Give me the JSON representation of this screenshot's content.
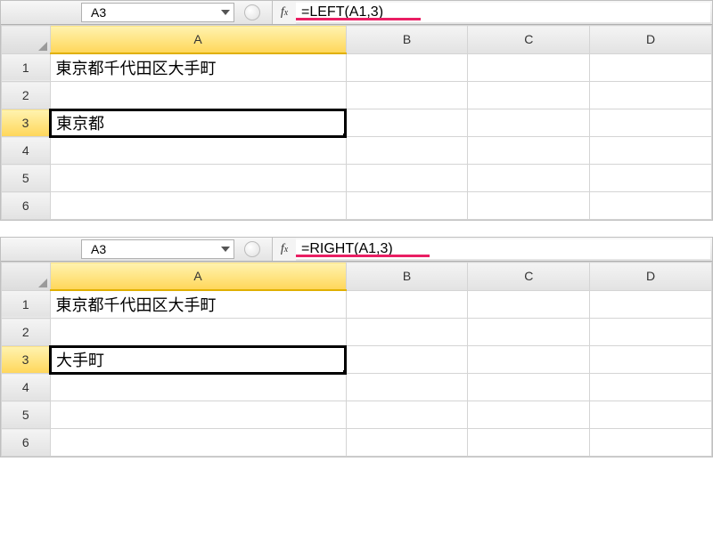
{
  "top": {
    "namebox": "A3",
    "formula": "=LEFT(A1,3)",
    "underline_left": 0,
    "underline_width": 140,
    "columns": [
      "A",
      "B",
      "C",
      "D"
    ],
    "rows": [
      "1",
      "2",
      "3",
      "4",
      "5",
      "6"
    ],
    "selected_col": "A",
    "selected_row": "3",
    "cells": {
      "A1": "東京都千代田区大手町",
      "A3": "東京都"
    }
  },
  "bottom": {
    "namebox": "A3",
    "formula": "=RIGHT(A1,3)",
    "underline_left": 0,
    "underline_width": 150,
    "columns": [
      "A",
      "B",
      "C",
      "D"
    ],
    "rows": [
      "1",
      "2",
      "3",
      "4",
      "5",
      "6"
    ],
    "selected_col": "A",
    "selected_row": "3",
    "cells": {
      "A1": "東京都千代田区大手町",
      "A3": "大手町"
    }
  }
}
